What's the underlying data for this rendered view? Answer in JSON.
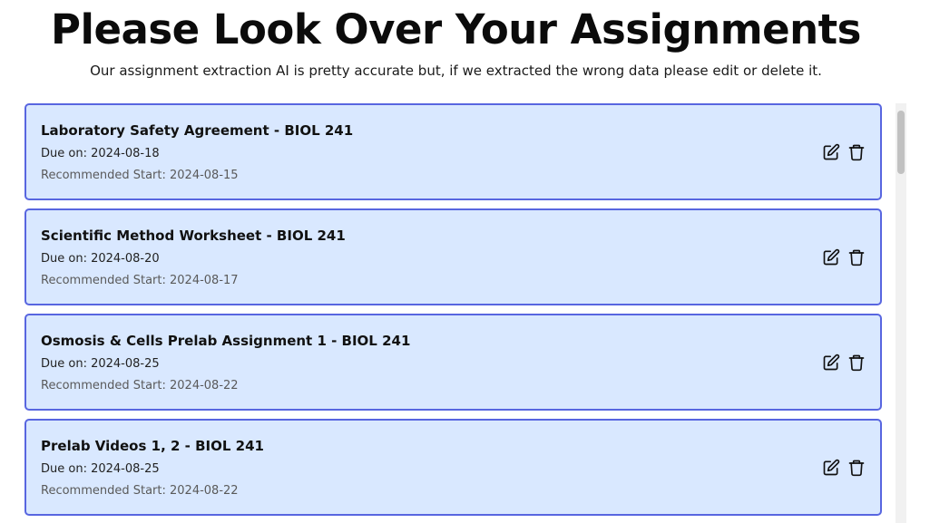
{
  "header": {
    "title": "Please Look Over Your Assignments",
    "subtitle": "Our assignment extraction AI is pretty accurate but, if we extracted the wrong data please edit or delete it."
  },
  "assignments": [
    {
      "name": "Laboratory Safety Agreement - BIOL 241",
      "due": "Due on: 2024-08-18",
      "start": "Recommended Start: 2024-08-15"
    },
    {
      "name": "Scientific Method Worksheet - BIOL 241",
      "due": "Due on: 2024-08-20",
      "start": "Recommended Start: 2024-08-17"
    },
    {
      "name": "Osmosis & Cells Prelab Assignment 1 - BIOL 241",
      "due": "Due on: 2024-08-25",
      "start": "Recommended Start: 2024-08-22"
    },
    {
      "name": "Prelab Videos 1, 2 - BIOL 241",
      "due": "Due on: 2024-08-25",
      "start": "Recommended Start: 2024-08-22"
    }
  ],
  "icons": {
    "edit": "edit-icon",
    "delete": "trash-icon"
  },
  "colors": {
    "card_background": "#d9e8ff",
    "card_border": "#5866e0"
  }
}
